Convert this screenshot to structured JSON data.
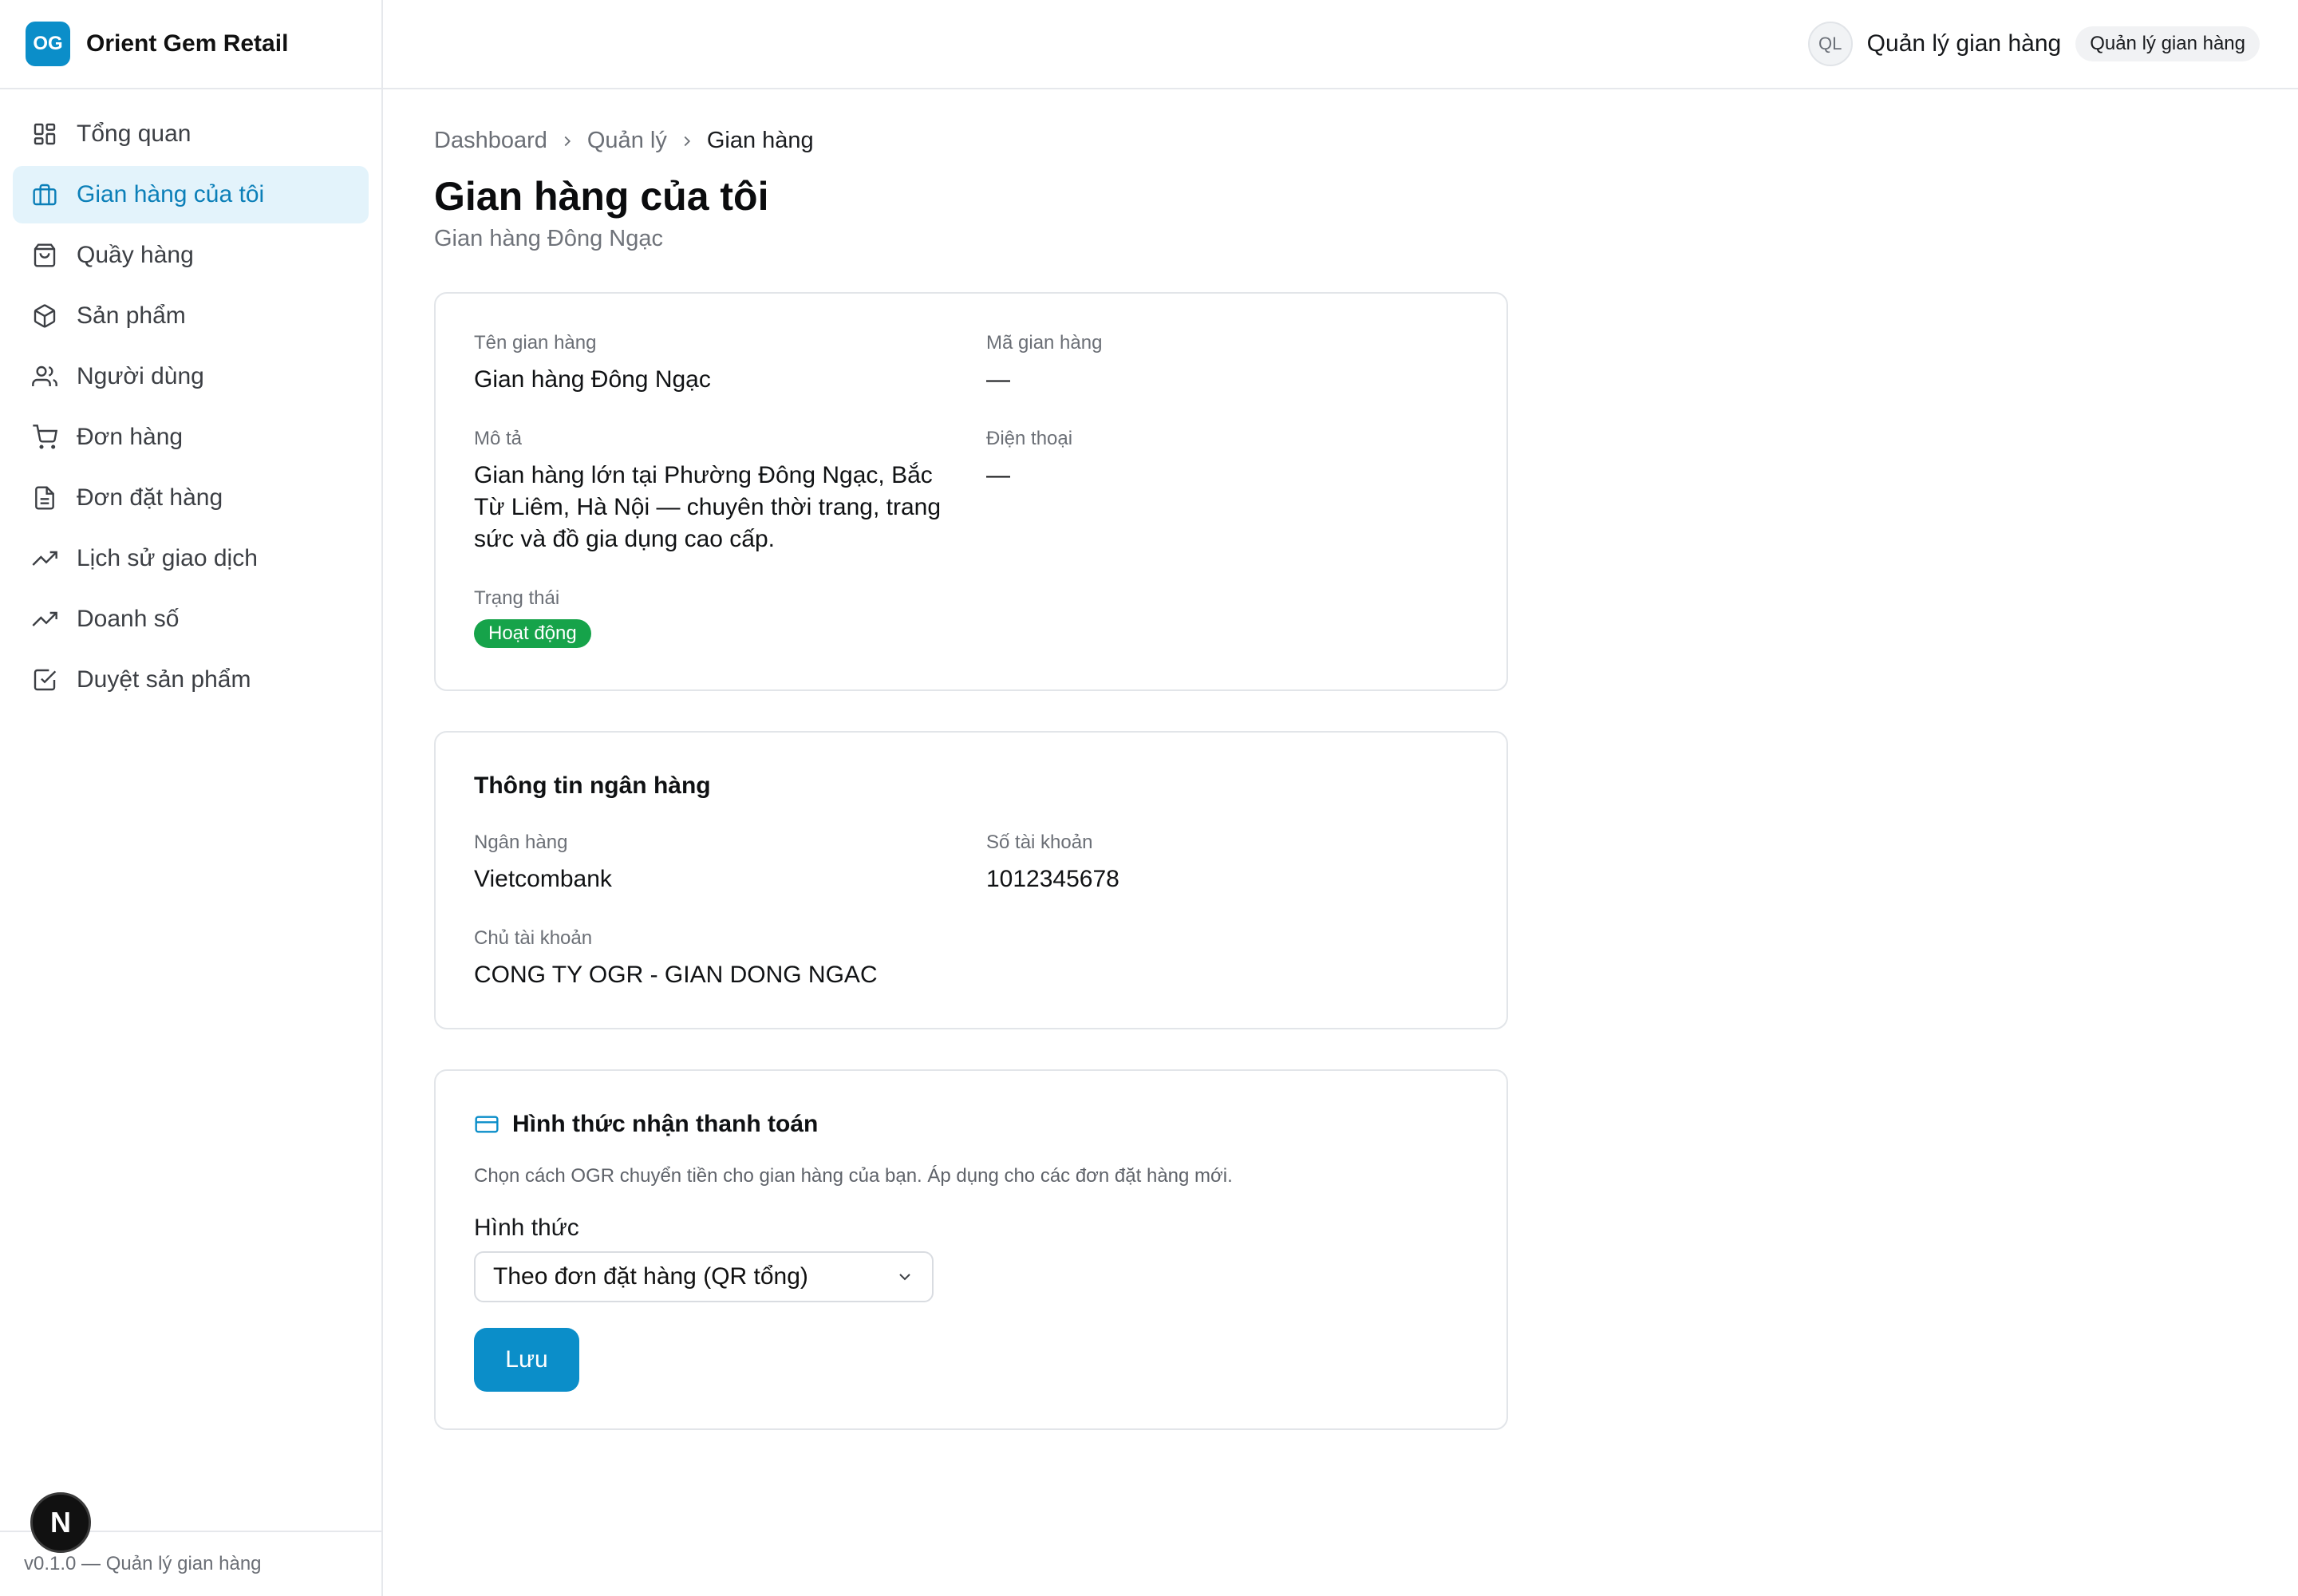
{
  "brand": {
    "logo_text": "OG",
    "name": "Orient Gem Retail",
    "accent_color": "#0b8ec9"
  },
  "sidebar": {
    "items": [
      {
        "label": "Tổng quan",
        "icon": "grid-icon"
      },
      {
        "label": "Gian hàng của tôi",
        "icon": "briefcase-icon",
        "active": true
      },
      {
        "label": "Quầy hàng",
        "icon": "bag-icon"
      },
      {
        "label": "Sản phẩm",
        "icon": "box-icon"
      },
      {
        "label": "Người dùng",
        "icon": "users-icon"
      },
      {
        "label": "Đơn hàng",
        "icon": "cart-icon"
      },
      {
        "label": "Đơn đặt hàng",
        "icon": "document-icon"
      },
      {
        "label": "Lịch sử giao dịch",
        "icon": "trending-up-icon"
      },
      {
        "label": "Doanh số",
        "icon": "trending-up-icon"
      },
      {
        "label": "Duyệt sản phẩm",
        "icon": "check-square-icon"
      }
    ],
    "footer": "v0.1.0 — Quản lý gian hàng",
    "next_badge": "N"
  },
  "header": {
    "avatar_initials": "QL",
    "user_name": "Quản lý gian hàng",
    "role": "Quản lý gian hàng"
  },
  "breadcrumb": [
    "Dashboard",
    "Quản lý",
    "Gian hàng"
  ],
  "page": {
    "title": "Gian hàng của tôi",
    "subtitle": "Gian hàng Đông Ngạc"
  },
  "store_info": {
    "name_label": "Tên gian hàng",
    "name_value": "Gian hàng Đông Ngạc",
    "code_label": "Mã gian hàng",
    "code_value": "—",
    "desc_label": "Mô tả",
    "desc_value": "Gian hàng lớn tại Phường Đông Ngạc, Bắc Từ Liêm, Hà Nội — chuyên thời trang, trang sức và đồ gia dụng cao cấp.",
    "phone_label": "Điện thoại",
    "phone_value": "—",
    "status_label": "Trạng thái",
    "status_value": "Hoạt động",
    "status_color": "#16a34a"
  },
  "bank_info": {
    "title": "Thông tin ngân hàng",
    "bank_label": "Ngân hàng",
    "bank_value": "Vietcombank",
    "account_label": "Số tài khoản",
    "account_value": "1012345678",
    "holder_label": "Chủ tài khoản",
    "holder_value": "CONG TY OGR - GIAN DONG NGAC"
  },
  "payment": {
    "title": "Hình thức nhận thanh toán",
    "description": "Chọn cách OGR chuyển tiền cho gian hàng của bạn. Áp dụng cho các đơn đặt hàng mới.",
    "form_label": "Hình thức",
    "selected": "Theo đơn đặt hàng (QR tổng)",
    "save_label": "Lưu"
  }
}
